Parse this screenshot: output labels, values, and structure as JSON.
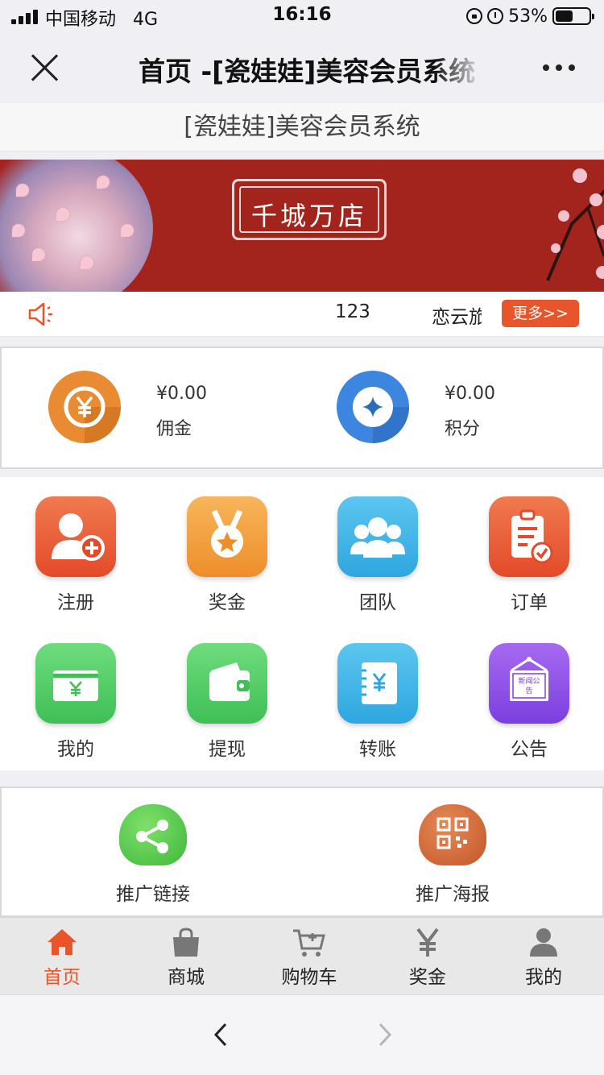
{
  "status_bar": {
    "carrier": "中国移动",
    "network": "4G",
    "time": "16:16",
    "battery": "53%",
    "battery_level": 0.53
  },
  "nav": {
    "title": "首页 -[瓷娃娃]美容会员系统"
  },
  "site": {
    "header": "[瓷娃娃]美容会员系统"
  },
  "banner": {
    "text": "千城万店",
    "bg_color": "#a3231d"
  },
  "notice": {
    "items": [
      "123",
      "恋云旅"
    ],
    "more_label": "更多>>"
  },
  "balance": [
    {
      "value": "¥0.00",
      "label": "佣金",
      "icon": "yuan-coin-icon",
      "color": "#e88b32"
    },
    {
      "value": "¥0.00",
      "label": "积分",
      "icon": "points-diamond-icon",
      "color": "#3d86e0"
    }
  ],
  "grid": [
    {
      "label": "注册",
      "icon": "register-user-plus-icon"
    },
    {
      "label": "奖金",
      "icon": "medal-icon"
    },
    {
      "label": "团队",
      "icon": "team-icon"
    },
    {
      "label": "订单",
      "icon": "order-clipboard-icon"
    },
    {
      "label": "我的",
      "icon": "wallet-card-icon"
    },
    {
      "label": "提现",
      "icon": "withdraw-wallet-icon"
    },
    {
      "label": "转账",
      "icon": "transfer-icon"
    },
    {
      "label": "公告",
      "icon": "announcement-board-icon",
      "board_text": "新闻公告"
    }
  ],
  "share": [
    {
      "label": "推广链接",
      "icon": "share-icon"
    },
    {
      "label": "推广海报",
      "icon": "qrcode-icon"
    }
  ],
  "tabbar": [
    {
      "label": "首页",
      "icon": "home-icon",
      "active": true
    },
    {
      "label": "商城",
      "icon": "shopping-bag-icon"
    },
    {
      "label": "购物车",
      "icon": "cart-icon"
    },
    {
      "label": "奖金",
      "icon": "yen-icon"
    },
    {
      "label": "我的",
      "icon": "user-icon"
    }
  ],
  "theme": {
    "accent": "#e9552a",
    "inactive_tab": "#777777"
  }
}
